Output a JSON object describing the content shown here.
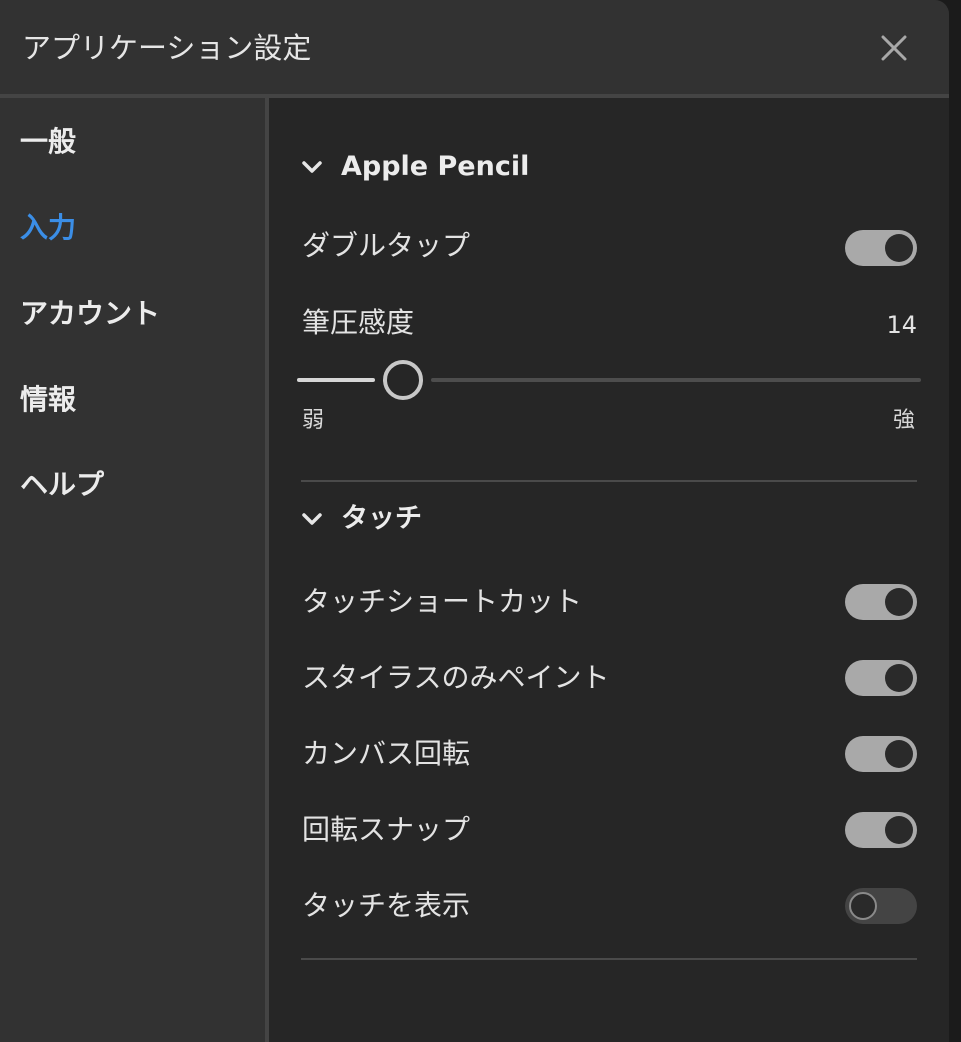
{
  "window": {
    "title": "アプリケーション設定",
    "close_icon": "close-icon"
  },
  "sidebar": {
    "items": [
      {
        "label": "一般",
        "active": false
      },
      {
        "label": "入力",
        "active": true
      },
      {
        "label": "アカウント",
        "active": false
      },
      {
        "label": "情報",
        "active": false
      },
      {
        "label": "ヘルプ",
        "active": false
      }
    ],
    "active_color": "#3b8ee6"
  },
  "main": {
    "apple_pencil": {
      "title": "Apple Pencil",
      "double_tap": {
        "label": "ダブルタップ",
        "on": true
      },
      "pressure": {
        "label": "筆圧感度",
        "value": "14",
        "slider_fraction": 0.138,
        "min_label": "弱",
        "max_label": "強"
      }
    },
    "touch": {
      "title": "タッチ",
      "items": [
        {
          "label": "タッチショートカット",
          "on": true
        },
        {
          "label": "スタイラスのみペイント",
          "on": true
        },
        {
          "label": "カンバス回転",
          "on": true
        },
        {
          "label": "回転スナップ",
          "on": true
        },
        {
          "label": "タッチを表示",
          "on": false
        }
      ]
    }
  }
}
